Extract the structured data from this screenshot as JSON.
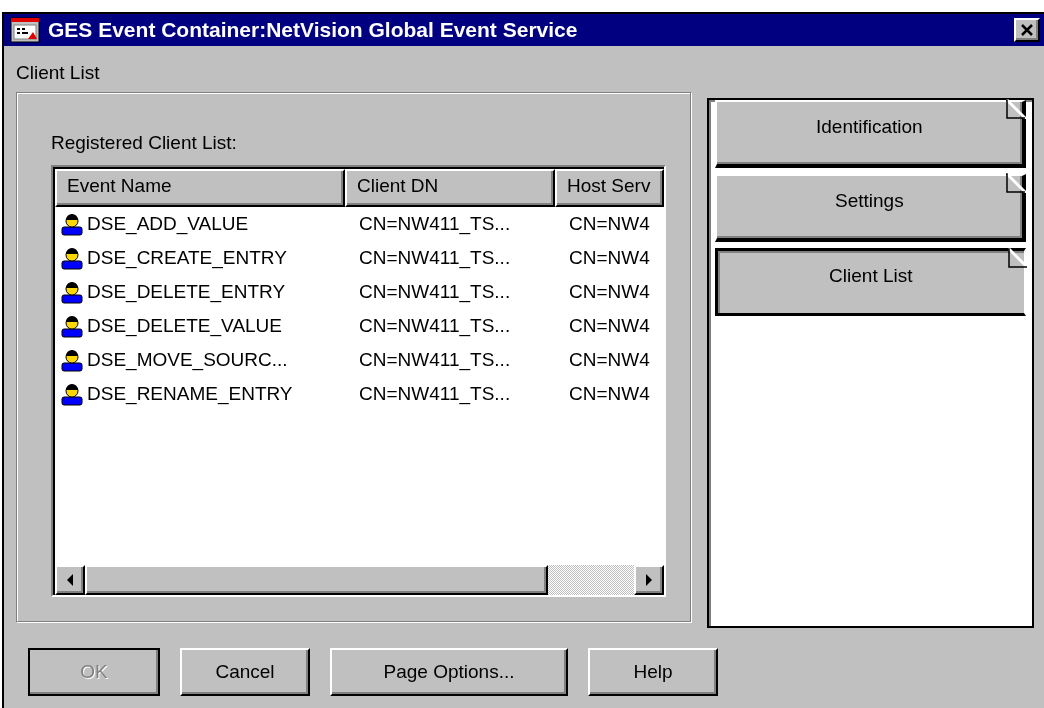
{
  "window": {
    "title": "GES Event Container:NetVision Global Event Service"
  },
  "page": {
    "title": "Client List",
    "list_label": "Registered Client List:"
  },
  "table": {
    "columns": [
      "Event Name",
      "Client DN",
      "Host Serv"
    ],
    "rows": [
      {
        "cells": [
          "DSE_ADD_VALUE",
          "CN=NW411_TS...",
          "CN=NW4"
        ]
      },
      {
        "cells": [
          "DSE_CREATE_ENTRY",
          "CN=NW411_TS...",
          "CN=NW4"
        ]
      },
      {
        "cells": [
          "DSE_DELETE_ENTRY",
          "CN=NW411_TS...",
          "CN=NW4"
        ]
      },
      {
        "cells": [
          "DSE_DELETE_VALUE",
          "CN=NW411_TS...",
          "CN=NW4"
        ]
      },
      {
        "cells": [
          "DSE_MOVE_SOURC...",
          "CN=NW411_TS...",
          "CN=NW4"
        ]
      },
      {
        "cells": [
          "DSE_RENAME_ENTRY",
          "CN=NW411_TS...",
          "CN=NW4"
        ]
      }
    ]
  },
  "pages": [
    {
      "label": "Identification",
      "selected": false
    },
    {
      "label": "Settings",
      "selected": false
    },
    {
      "label": "Client List",
      "selected": true
    }
  ],
  "buttons": [
    {
      "label": "OK",
      "disabled": true
    },
    {
      "label": "Cancel",
      "disabled": false
    },
    {
      "label": "Page Options...",
      "disabled": false
    },
    {
      "label": "Help",
      "disabled": false
    }
  ]
}
